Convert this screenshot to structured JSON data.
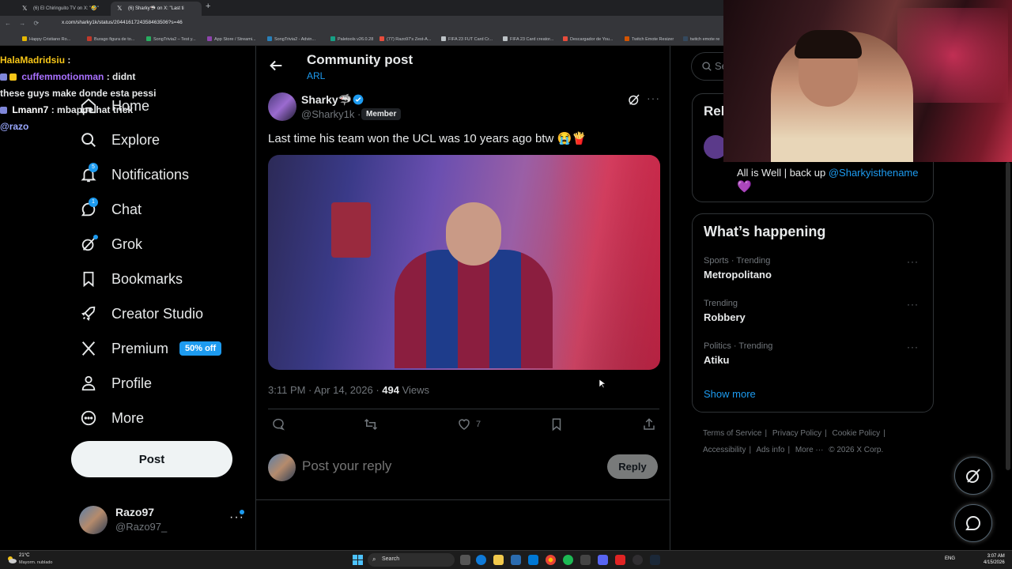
{
  "browser": {
    "tabs": [
      {
        "title": "(6) El Chiringuito TV on X: \"🤣\""
      },
      {
        "title": "(6) Sharky🦈 on X: \"Last ti"
      }
    ],
    "url": "x.com/sharky1k/status/2044161724358463506?s=46",
    "bookmarks": [
      "Happy Cristiano Ro...",
      "Burago figura de to...",
      "SongTrivia2 – Test y...",
      "App Store / Streami...",
      "SongTrivia2 - Advin...",
      "Paletools v26.0.28",
      "(77) Razo97's Zest-A...",
      "FIFA 23 FUT Card Cr...",
      "FIFA 23 Card creator...",
      "Descargador de You...",
      "Twitch Emote Resizer",
      "twitch emote re"
    ]
  },
  "chat": [
    {
      "user": "HalaMadridsiu",
      "text": ":"
    },
    {
      "user": "cuffemmotionman",
      "text": ": didnt these guys make donde esta pessi"
    },
    {
      "user": "Lmann7",
      "text": ": mbappe hat trick"
    },
    {
      "user": "",
      "text": "@razo"
    }
  ],
  "nav": {
    "home": "Home",
    "explore": "Explore",
    "notifications": "Notifications",
    "notifications_badge": "5",
    "chat": "Chat",
    "chat_badge": "1",
    "grok": "Grok",
    "bookmarks": "Bookmarks",
    "creator_studio": "Creator Studio",
    "premium": "Premium",
    "premium_badge": "50% off",
    "profile": "Profile",
    "more": "More",
    "post_button": "Post"
  },
  "account": {
    "name": "Razo97",
    "handle": "@Razo97_"
  },
  "main": {
    "title": "Community post",
    "community": "ARL",
    "author_name": "Sharky🦈",
    "author_handle": "@Sharky1k",
    "member_label": "Member",
    "separator": "·",
    "post_text": "Last time his team won the UCL was 10 years ago btw 😭🍟",
    "timestamp": "3:11 PM · Apr 14, 2026 · ",
    "views_count": "494",
    "views_label": " Views",
    "likes_count": "7",
    "reply_placeholder": "Post your reply",
    "reply_button": "Reply"
  },
  "right": {
    "search_placeholder": "Se",
    "relevant_title": "Rel",
    "relevant_bio": "All is Well | back up ",
    "relevant_mention": "@Sharkyisthename",
    "relevant_heart": "💜",
    "trends_title": "What’s happening",
    "trends": [
      {
        "category": "Sports · Trending",
        "name": "Metropolitano"
      },
      {
        "category": "Trending",
        "name": "Robbery"
      },
      {
        "category": "Politics · Trending",
        "name": "Atiku"
      }
    ],
    "show_more": "Show more",
    "footer": [
      "Terms of Service",
      "|",
      "Privacy Policy",
      "|",
      "Cookie Policy",
      "|",
      "Accessibility",
      "|",
      "Ads info",
      "|",
      "More ···",
      "© 2026 X Corp."
    ]
  },
  "taskbar": {
    "weather_temp": "21°C",
    "weather_desc": "Mayorm. nublado",
    "search": "Search",
    "lang": "ENG",
    "time": "3:07 AM",
    "date": "4/15/2026"
  },
  "colors": {
    "accent": "#1d9bf0",
    "background": "#000000",
    "text": "#e7e9ea",
    "muted": "#71767b"
  }
}
